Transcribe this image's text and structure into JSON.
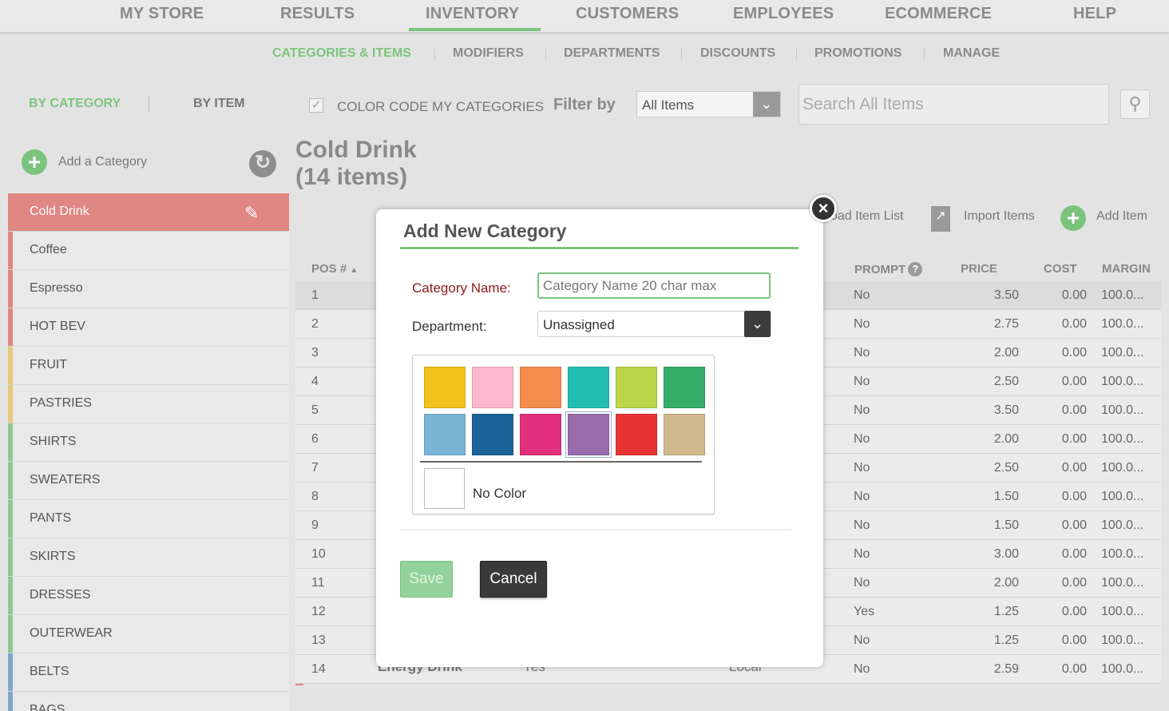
{
  "topnav": {
    "tabs": [
      {
        "label": "MY STORE"
      },
      {
        "label": "RESULTS"
      },
      {
        "label": "INVENTORY"
      },
      {
        "label": "CUSTOMERS"
      },
      {
        "label": "EMPLOYEES"
      },
      {
        "label": "ECOMMERCE"
      },
      {
        "label": "HELP"
      }
    ],
    "active": "INVENTORY"
  },
  "subnav": {
    "items": [
      {
        "label": "CATEGORIES & ITEMS"
      },
      {
        "label": "MODIFIERS"
      },
      {
        "label": "DEPARTMENTS"
      },
      {
        "label": "DISCOUNTS"
      },
      {
        "label": "PROMOTIONS"
      },
      {
        "label": "MANAGE"
      }
    ],
    "active": "CATEGORIES & ITEMS"
  },
  "view_toggle": {
    "by_category": "BY CATEGORY",
    "by_item": "BY ITEM"
  },
  "sidebar": {
    "add_label": "Add a Category",
    "categories": [
      {
        "name": "Cold Drink",
        "color": "#e08683"
      },
      {
        "name": "Coffee",
        "color": "#e08683"
      },
      {
        "name": "Espresso",
        "color": "#e08683"
      },
      {
        "name": "HOT BEV",
        "color": "#e08683"
      },
      {
        "name": "FRUIT",
        "color": "#e8c77a"
      },
      {
        "name": "PASTRIES",
        "color": "#e8c77a"
      },
      {
        "name": "SHIRTS",
        "color": "#8fc896"
      },
      {
        "name": "SWEATERS",
        "color": "#8fc896"
      },
      {
        "name": "PANTS",
        "color": "#8fc896"
      },
      {
        "name": "SKIRTS",
        "color": "#8fc896"
      },
      {
        "name": "DRESSES",
        "color": "#8fc896"
      },
      {
        "name": "OUTERWEAR",
        "color": "#8fc896"
      },
      {
        "name": "BELTS",
        "color": "#7fa6c9"
      },
      {
        "name": "BAGS",
        "color": "#7fa6c9"
      }
    ]
  },
  "toolbar": {
    "color_code_label": "COLOR CODE MY CATEGORIES",
    "filter_label": "Filter by",
    "filter_value": "All Items",
    "search_placeholder": "Search All Items"
  },
  "main": {
    "title_line1": "Cold Drink",
    "title_line2": "(14 items)",
    "actions": {
      "download": "oad Item List",
      "import": "Import Items",
      "add": "Add Item"
    },
    "columns": {
      "pos": "POS #",
      "prompt": "PROMPT",
      "price": "PRICE",
      "cost": "COST",
      "margin": "MARGIN"
    },
    "rows": [
      {
        "pos": "1",
        "prompt": "No",
        "price": "3.50",
        "cost": "0.00",
        "margin": "100.0..."
      },
      {
        "pos": "2",
        "prompt": "No",
        "price": "2.75",
        "cost": "0.00",
        "margin": "100.0..."
      },
      {
        "pos": "3",
        "prompt": "No",
        "price": "2.00",
        "cost": "0.00",
        "margin": "100.0..."
      },
      {
        "pos": "4",
        "prompt": "No",
        "price": "2.50",
        "cost": "0.00",
        "margin": "100.0..."
      },
      {
        "pos": "5",
        "prompt": "No",
        "price": "3.50",
        "cost": "0.00",
        "margin": "100.0..."
      },
      {
        "pos": "6",
        "prompt": "No",
        "price": "2.00",
        "cost": "0.00",
        "margin": "100.0..."
      },
      {
        "pos": "7",
        "prompt": "No",
        "price": "2.50",
        "cost": "0.00",
        "margin": "100.0..."
      },
      {
        "pos": "8",
        "prompt": "No",
        "price": "1.50",
        "cost": "0.00",
        "margin": "100.0..."
      },
      {
        "pos": "9",
        "prompt": "No",
        "price": "1.50",
        "cost": "0.00",
        "margin": "100.0..."
      },
      {
        "pos": "10",
        "prompt": "No",
        "price": "3.00",
        "cost": "0.00",
        "margin": "100.0..."
      },
      {
        "pos": "11",
        "prompt": "No",
        "price": "2.00",
        "cost": "0.00",
        "margin": "100.0..."
      },
      {
        "pos": "12",
        "prompt": "Yes",
        "price": "1.25",
        "cost": "0.00",
        "margin": "100.0..."
      },
      {
        "pos": "13",
        "prompt": "No",
        "price": "1.25",
        "cost": "0.00",
        "margin": "100.0..."
      },
      {
        "pos": "14",
        "prompt": "No",
        "price": "2.59",
        "cost": "0.00",
        "margin": "100.0..."
      }
    ],
    "last_row_peek": {
      "name": "Energy Drink",
      "col2": "Yes",
      "col3": "Local"
    }
  },
  "modal": {
    "title": "Add New Category",
    "name_label": "Category Name:",
    "name_placeholder": "Category Name 20 char max",
    "dept_label": "Department:",
    "dept_value": "Unassigned",
    "swatches": [
      "#f2c31a",
      "#fdb8cf",
      "#f48d4d",
      "#22bfb1",
      "#bcd64a",
      "#37ad6a",
      "#79b6d6",
      "#1b6298",
      "#e3307c",
      "#9a6bad",
      "#e83333",
      "#d2b98c"
    ],
    "selected_swatch": 9,
    "no_color_label": "No Color",
    "save_label": "Save",
    "cancel_label": "Cancel"
  }
}
